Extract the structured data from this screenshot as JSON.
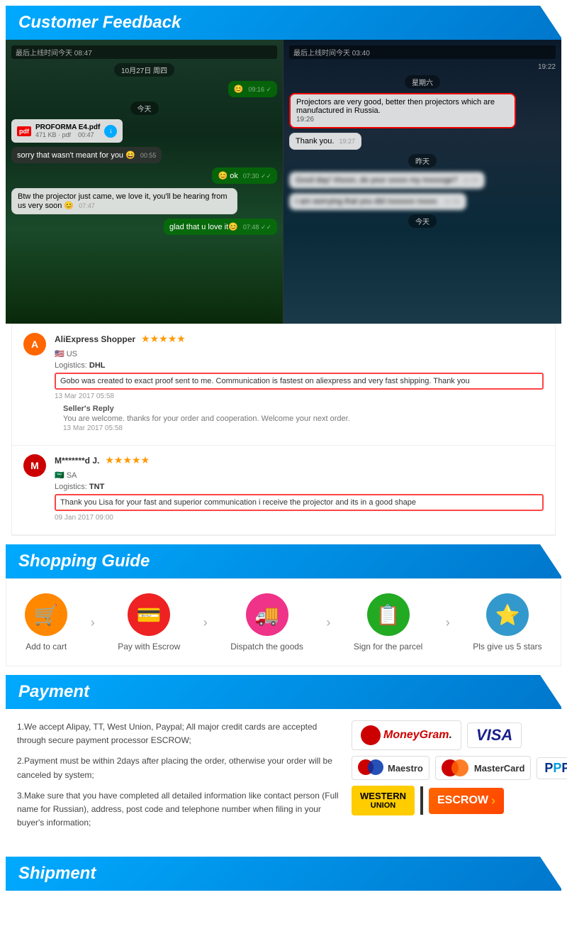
{
  "sections": {
    "customer_feedback": {
      "title": "Customer Feedback"
    },
    "shopping_guide": {
      "title": "Shopping Guide",
      "steps": [
        {
          "label": "Add to cart",
          "icon": "🛒",
          "color": "icon-orange"
        },
        {
          "label": "Pay with Escrow",
          "icon": "💳",
          "color": "icon-red"
        },
        {
          "label": "Dispatch the goods",
          "icon": "🚚",
          "color": "icon-pink"
        },
        {
          "label": "Sign for the parcel",
          "icon": "📋",
          "color": "icon-green"
        },
        {
          "label": "Pls give us 5 stars",
          "icon": "⭐",
          "color": "icon-blue"
        }
      ]
    },
    "payment": {
      "title": "Payment",
      "points": [
        "1.We accept Alipay, TT, West Union, Paypal; All major credit cards are accepted through secure payment processor ESCROW;",
        "2.Payment must be within 2days after placing the order, otherwise your order will be canceled by system;",
        "3.Make sure that you have completed all detailed information like contact person (Full name for Russian), address, post code and telephone number when filing in your buyer's information;"
      ]
    },
    "shipment": {
      "title": "Shipment"
    }
  },
  "chat_left": {
    "header": "最后上线时间今天 08:47",
    "date1": "10月27日 周四",
    "time1": "09:16 ✓",
    "today_label": "今天",
    "file_name": "PROFORMA E4.pdf",
    "file_size": "471 KB · pdf",
    "file_time": "00:47",
    "msg1": "sorry that wasn't meant for you 😄",
    "msg1_time": "00:55",
    "ok_msg": "😊 ok",
    "ok_time": "07:30 ✓✓",
    "projector_msg": "Btw the projector just came, we love it, you'll be hearing from us very soon 😊",
    "projector_time": "07:47",
    "glad_msg": "glad that u love it😊",
    "glad_time": "07:48 ✓✓"
  },
  "chat_right": {
    "header": "最后上线时间今天 03:40",
    "time_right": "19:22",
    "date_right": "星期六",
    "projector_review": "Projectors are very good, better then projectors which are manufactured in Russia.",
    "thank_you": "Thank you.",
    "thank_time": "19:27",
    "yesterday": "昨天",
    "blurred1": "Gxxx day! Vixxxn, do your xxxxx my mxxxxge?",
    "blurred1_time": "21:55",
    "blurred2": "I am worrying that you did nxxxxxx nxxxx.",
    "blurred2_time": "21:56",
    "today_right": "今天"
  },
  "reviews": [
    {
      "avatar_letter": "A",
      "avatar_class": "avatar-orange",
      "name": "AliExpress Shopper",
      "country": "US",
      "stars": "★★★★★",
      "logistics": "DHL",
      "review_text": "Gobo was created to exact proof sent to me. Communication is fastest on aliexpress and very fast shipping. Thank you",
      "date": "13 Mar 2017 05:58",
      "seller_reply": "You are welcome. thanks for your order and cooperation. Welcome your next order.",
      "seller_reply_date": "13 Mar 2017 05:58"
    },
    {
      "avatar_letter": "M",
      "avatar_class": "avatar-red",
      "name": "M*******d J.",
      "country": "SA",
      "stars": "★★★★★",
      "logistics": "TNT",
      "review_text": "Thank you Lisa for your fast and superior communication i receive the projector and its in a good shape",
      "date": "09 Jan 2017 09:00",
      "seller_reply": null,
      "seller_reply_date": null
    }
  ]
}
